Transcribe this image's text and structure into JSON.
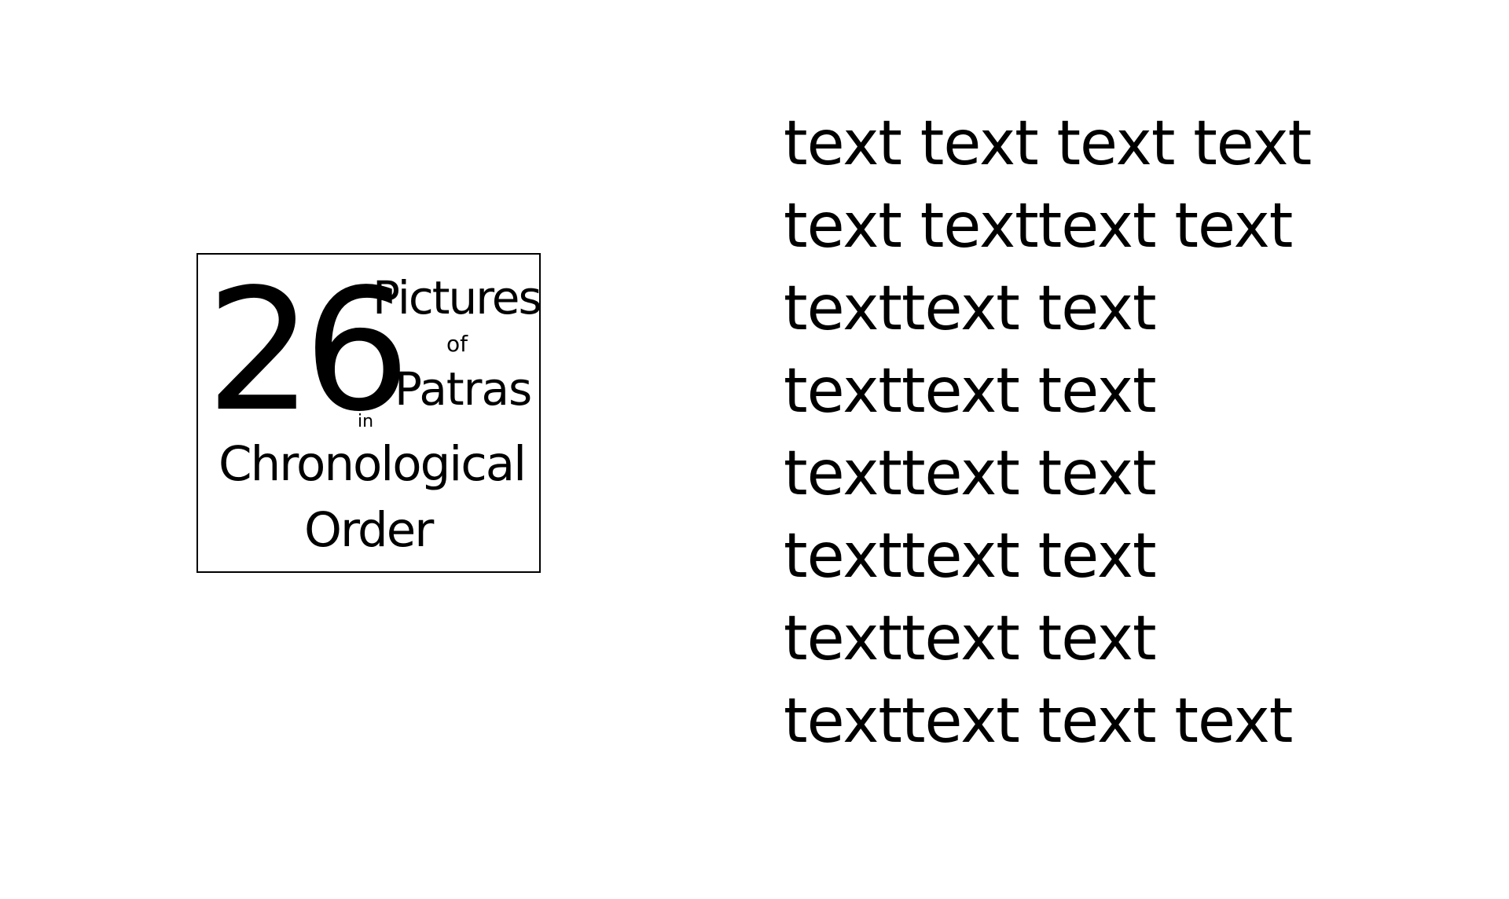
{
  "title_box": {
    "number": "26",
    "word_pictures": "Pictures",
    "word_of": "of",
    "word_patras": "Patras",
    "word_in": "in",
    "word_chronological": "Chronological",
    "word_order": "Order"
  },
  "text_lines": [
    "text text text text",
    "text texttext text",
    "texttext text",
    "texttext text",
    "texttext text",
    "texttext text",
    "texttext text",
    "texttext text text"
  ]
}
